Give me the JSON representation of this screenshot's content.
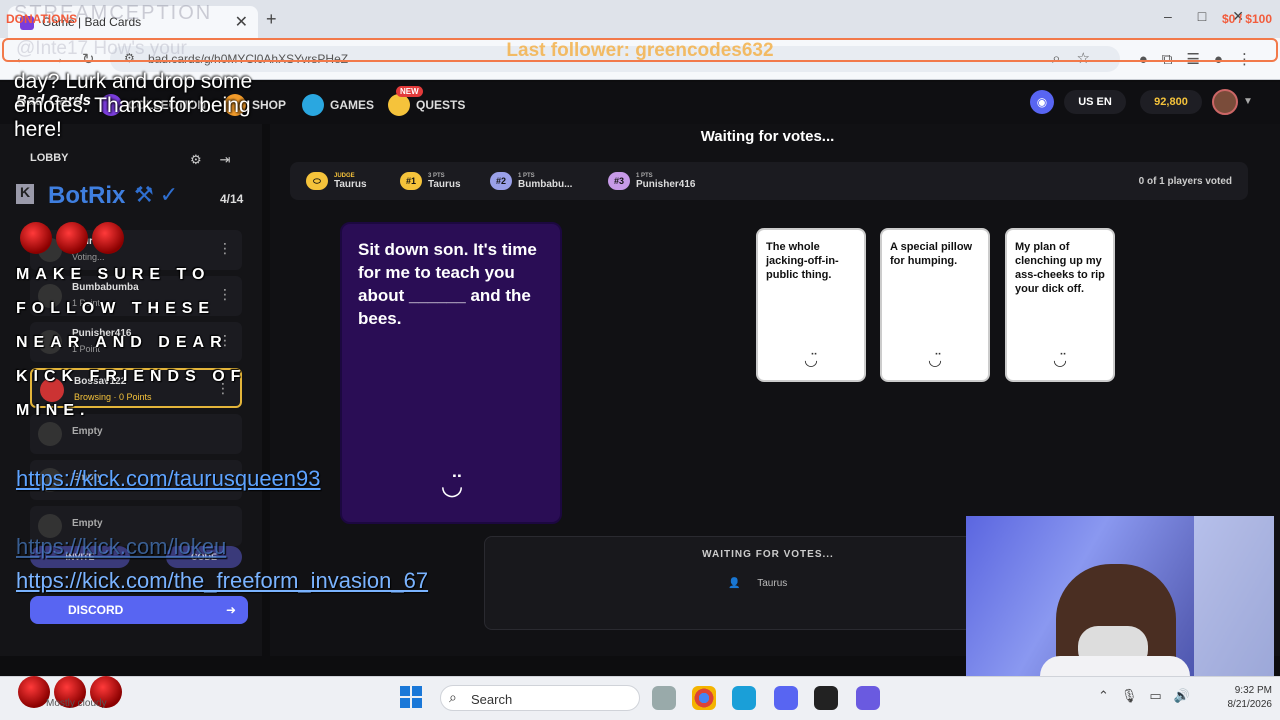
{
  "browser": {
    "tab_title": "Game | Bad Cards",
    "url": "bad.cards/g/h0MYCl0AhXSYvrsPHeZ",
    "new_tab": "+",
    "tab_close": "✕"
  },
  "overlay": {
    "follower": "Last follower: greencodes632",
    "donations": "DONATIONS",
    "goal": "$0 / $100",
    "streamception": "STREAMCEPTION"
  },
  "nav": {
    "logo": "Bad Cards",
    "collection": "COLLECTION",
    "shop": "SHOP",
    "games": "GAMES",
    "quests": "QUESTS",
    "new_badge": "NEW",
    "lang": "US EN",
    "coins": "92,800"
  },
  "game": {
    "status": "Waiting for votes...",
    "players_voted": "0 of 1 players voted",
    "scores": [
      {
        "badge": "",
        "pts": "JUDGE",
        "name": "Taurus"
      },
      {
        "badge": "#1",
        "pts": "3 PTS",
        "name": "Taurus"
      },
      {
        "badge": "#2",
        "pts": "1 PTS",
        "name": "Bumbabu..."
      },
      {
        "badge": "#3",
        "pts": "1 PTS",
        "name": "Punisher416"
      }
    ],
    "black_card": "Sit down son. It's time for me to teach you about ______ and the bees.",
    "white_cards": [
      "The whole jacking-off-in-public thing.",
      "A special pillow for humping.",
      "My plan of clenching up my ass-cheeks to rip your dick off."
    ],
    "vote_panel_title": "WAITING FOR VOTES...",
    "vote_chip": "Taurus"
  },
  "lobby": {
    "title": "LOBBY",
    "player_count": "4/14",
    "players": [
      {
        "name": "Taurus",
        "status": "Voting..."
      },
      {
        "name": "Bumbabumba",
        "status": "1 Point"
      },
      {
        "name": "Punisher416",
        "status": "1 Point"
      },
      {
        "name": "Bossav122",
        "status": "Browsing · 0 Points"
      }
    ],
    "empty": [
      "Empty",
      "Empty",
      "Empty"
    ],
    "invite": "INVITE",
    "code": "CODE",
    "discord": "DISCORD"
  },
  "chat": {
    "ghost": "@Inte17 How's your",
    "message": "day? Lurk and drop some emotes. Thanks for being here!",
    "bot_name": "BotRix",
    "bot_message": "MAKE SURE TO FOLLOW THESE NEAR AND DEAR KICK FRIENDS OF MINE.",
    "link1": "https://kick.com/taurusqueen93",
    "link2": "https://kick.com/lokeu",
    "link3": "https://kick.com/the_freeform_invasion_67"
  },
  "taskbar": {
    "weather": "Mostly cloudy",
    "search": "Search",
    "time": "9:32 PM",
    "date": "8/21/2026"
  }
}
